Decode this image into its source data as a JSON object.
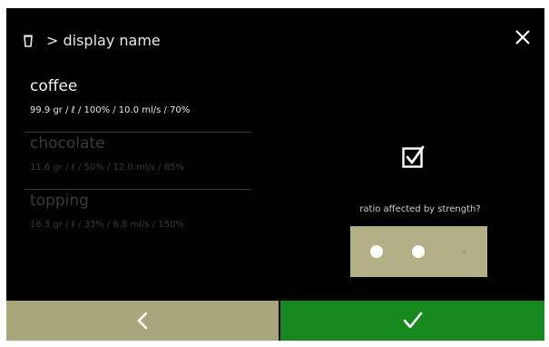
{
  "header": {
    "title": "> display name"
  },
  "ingredients": [
    {
      "name": "coffee",
      "detail": "99.9 gr  / ℓ / 100% / 10.0 ml/s / 70%",
      "selected": true
    },
    {
      "name": "chocolate",
      "detail": "11.6 gr  / ℓ / 50% / 12.0 ml/s / 85%",
      "selected": false
    },
    {
      "name": "topping",
      "detail": "16.3 gr  / ℓ / 33% / 6.8 ml/s / 150%",
      "selected": false
    }
  ],
  "settings": {
    "checkbox_checked": true,
    "ratio_label": "ratio affected by strength?",
    "strength_level": 2,
    "strength_max": 3
  },
  "footer": {
    "back_icon": "chevron-left-icon",
    "confirm_icon": "checkmark-icon"
  },
  "colors": {
    "background": "#000000",
    "footer_back": "#a9a67b",
    "footer_confirm": "#18891f",
    "stepper": "#b3b088"
  }
}
